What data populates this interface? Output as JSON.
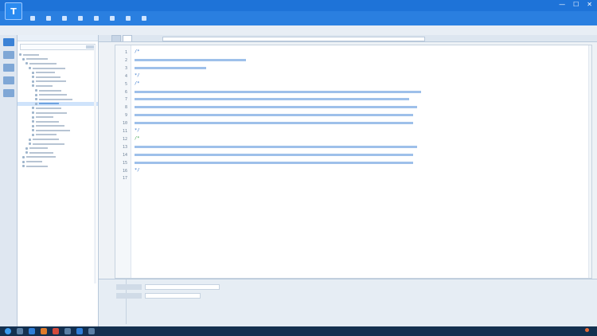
{
  "window": {
    "logo_glyph": "T",
    "title": "",
    "controls": [
      "—",
      "☐",
      "✕"
    ]
  },
  "toolbar": {
    "buttons": [
      {
        "label": "",
        "icon": "new-icon"
      },
      {
        "label": "",
        "icon": "open-icon"
      },
      {
        "label": "",
        "icon": "save-icon"
      },
      {
        "label": "",
        "icon": "cut-icon"
      },
      {
        "label": "",
        "icon": "copy-icon"
      },
      {
        "label": "",
        "icon": "paste-icon"
      },
      {
        "label": "",
        "icon": "run-icon"
      },
      {
        "label": "",
        "icon": "settings-icon"
      }
    ]
  },
  "editor": {
    "tabs": [
      {
        "label": "",
        "active": false
      },
      {
        "label": "",
        "active": true
      }
    ],
    "path": "",
    "lines": [
      {
        "no": "1",
        "text": "/*",
        "color": "blue"
      },
      {
        "no": "2",
        "text": "",
        "color": "blue"
      },
      {
        "no": "3",
        "text": "",
        "color": "blue"
      },
      {
        "no": "4",
        "text": "*/",
        "color": "blue"
      },
      {
        "no": "5",
        "text": "/*",
        "color": "blue"
      },
      {
        "no": "6",
        "text": "",
        "color": "blue"
      },
      {
        "no": "7",
        "text": "",
        "color": "blue"
      },
      {
        "no": "8",
        "text": "",
        "color": "blue"
      },
      {
        "no": "9",
        "text": "",
        "color": "blue"
      },
      {
        "no": "10",
        "text": "",
        "color": "blue"
      },
      {
        "no": "11",
        "text": "*/",
        "color": "blue"
      },
      {
        "no": "12",
        "text": "/*",
        "color": "green"
      },
      {
        "no": "13",
        "text": "",
        "color": "blue"
      },
      {
        "no": "14",
        "text": "",
        "color": "blue"
      },
      {
        "no": "15",
        "text": "",
        "color": "blue"
      },
      {
        "no": "16",
        "text": "*/",
        "color": "blue"
      },
      {
        "no": "17",
        "text": "",
        "color": "blue"
      }
    ]
  },
  "colors": {
    "titlebar": "#1e73d8",
    "code_blue": "#2b6fc9",
    "code_green": "#3aa04a",
    "taskbar": "#14304f"
  }
}
